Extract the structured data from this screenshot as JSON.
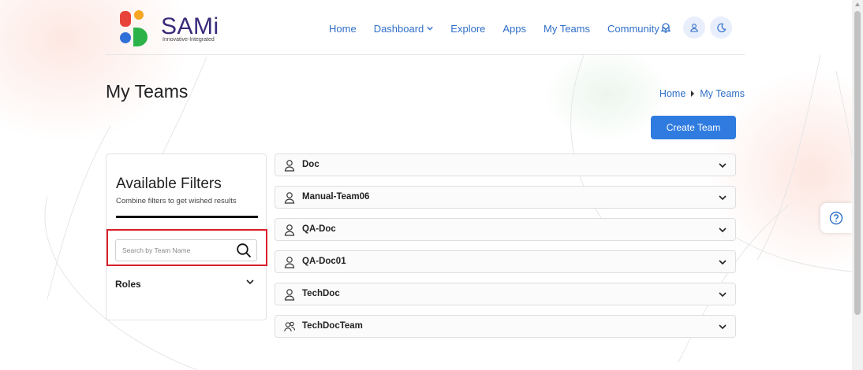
{
  "app": {
    "logo_text": "SAMi",
    "logo_tagline": "Innovative-Integrated"
  },
  "nav": {
    "items": [
      {
        "label": "Home",
        "has_dropdown": false
      },
      {
        "label": "Dashboard",
        "has_dropdown": true
      },
      {
        "label": "Explore",
        "has_dropdown": false
      },
      {
        "label": "Apps",
        "has_dropdown": false
      },
      {
        "label": "My Teams",
        "has_dropdown": false
      },
      {
        "label": "Community",
        "has_dropdown": true
      }
    ],
    "icons": [
      "bell-icon",
      "user-icon",
      "moon-icon"
    ]
  },
  "page": {
    "title": "My Teams",
    "breadcrumb": {
      "home": "Home",
      "current": "My Teams"
    },
    "create_button": "Create Team"
  },
  "filters": {
    "title": "Available Filters",
    "subtitle": "Combine filters to get wished results",
    "search": {
      "placeholder": "Search by Team Name",
      "value": ""
    },
    "roles_label": "Roles"
  },
  "teams": [
    {
      "name": "Doc",
      "icon": "user-icon"
    },
    {
      "name": "Manual-Team06",
      "icon": "user-icon"
    },
    {
      "name": "QA-Doc",
      "icon": "user-icon"
    },
    {
      "name": "QA-Doc01",
      "icon": "user-icon"
    },
    {
      "name": "TechDoc",
      "icon": "user-icon"
    },
    {
      "name": "TechDocTeam",
      "icon": "users-icon"
    }
  ],
  "colors": {
    "accent": "#2f6fc8",
    "button": "#2f7be0",
    "highlight": "#d8202a",
    "logo_red": "#e8433a",
    "logo_orange": "#f5a623",
    "logo_blue": "#2f6fd8",
    "logo_green": "#2bb34a"
  }
}
